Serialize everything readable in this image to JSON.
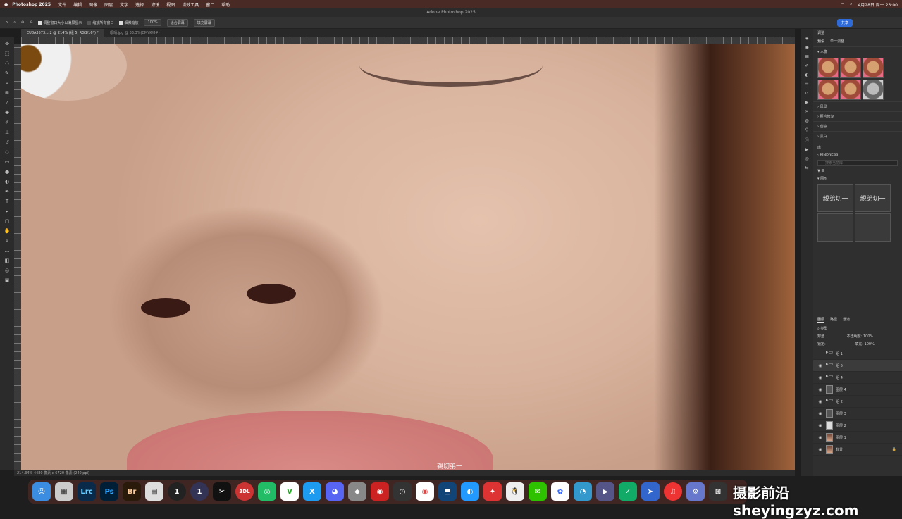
{
  "menubar": {
    "app": "Photoshop 2025",
    "items": [
      "文件",
      "编辑",
      "图像",
      "图层",
      "文字",
      "选择",
      "滤镜",
      "视图",
      "增效工具",
      "窗口",
      "帮助"
    ],
    "datetime": "4月28日 周一 23:00"
  },
  "window": {
    "title": "Adobe Photoshop 2025"
  },
  "options": {
    "resize_label": "调整窗口大小以满屏显示",
    "zoom_all_label": "缩放所有窗口",
    "scrubby_label": "细微缩放",
    "zoom_value": "100%",
    "fit_screen": "适合屏幕",
    "fill_screen": "填充屏幕",
    "share": "共享"
  },
  "tabs": [
    {
      "label": "EU8A3573.cr2 @ 214% (组 5, RGB/16*) *"
    },
    {
      "label": "眼晴.jpg @ 33.3%(CMYK/8#)"
    }
  ],
  "canvas": {
    "watermark": "親切弟一"
  },
  "status": {
    "text": "214.34%  4480 像素 x 6720 像素 (240 ppi)"
  },
  "adjust_panel": {
    "title": "调整",
    "tabs": [
      "预设",
      "单一调整"
    ],
    "groups": [
      "人像",
      "风景",
      "照片修复",
      "创意",
      "黑白"
    ]
  },
  "library_panel": {
    "title": "库",
    "library_name": "KINDNESS",
    "search_placeholder": "搜索当前库",
    "section": "图形",
    "glyph_text": "親弟切一"
  },
  "layers_panel": {
    "tabs": [
      "图层",
      "路径",
      "通道"
    ],
    "kind": "类型",
    "blend": "穿透",
    "opacity_label": "不透明度:",
    "opacity": "100%",
    "lock_label": "锁定:",
    "fill_label": "填充:",
    "fill": "100%",
    "layers": [
      {
        "name": "组 1",
        "type": "folder"
      },
      {
        "name": "组 5",
        "type": "folder",
        "selected": true
      },
      {
        "name": "组 4",
        "type": "folder"
      },
      {
        "name": "图层 4",
        "type": "dark"
      },
      {
        "name": "组 2",
        "type": "folder"
      },
      {
        "name": "图层 3",
        "type": "dark"
      },
      {
        "name": "图层 2",
        "type": "white"
      },
      {
        "name": "图层 1",
        "type": "photo"
      },
      {
        "name": "背景",
        "type": "photo"
      }
    ]
  },
  "dock": {
    "apps": [
      "Finder",
      "Launchpad",
      "Lrc",
      "Ps",
      "Br",
      "",
      "1",
      "1",
      "CapCut",
      "3DL",
      "",
      "",
      "X",
      "Discord",
      "",
      "",
      "",
      "Chrome",
      "",
      "",
      "",
      "",
      "",
      "WeChat",
      "",
      "",
      "",
      "",
      "",
      "",
      "",
      "",
      ""
    ],
    "brand": "摄影前沿sheyingzyz.com"
  }
}
